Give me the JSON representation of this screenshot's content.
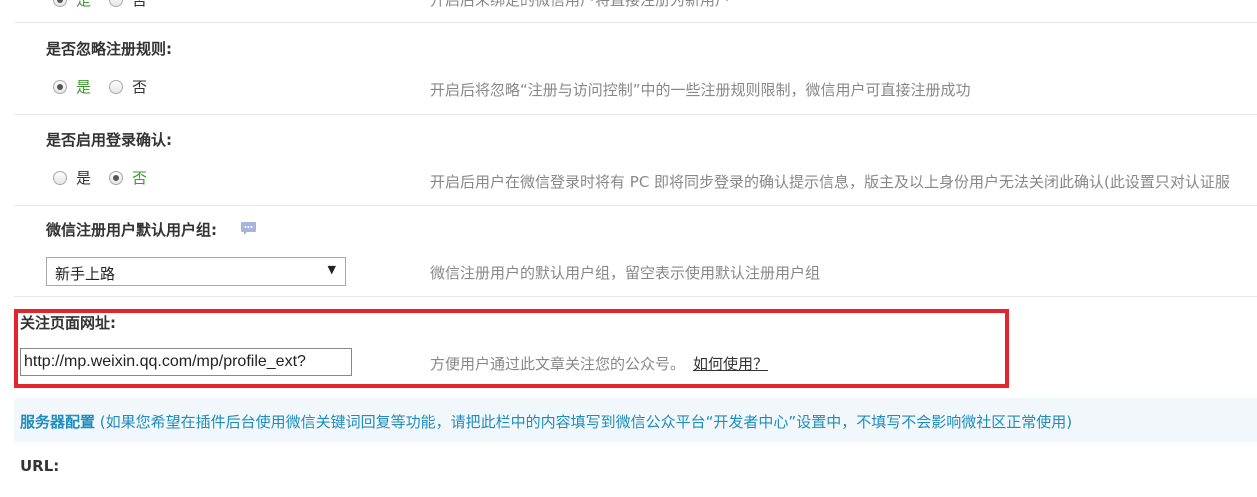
{
  "top_partial": {
    "yes": "是",
    "no": "否",
    "desc": "开启后未绑定的微信用户将直接注册为新用户"
  },
  "ignore_rules": {
    "label": "是否忽略注册规则:",
    "yes": "是",
    "no": "否",
    "selected": "yes",
    "desc": "开启后将忽略“注册与访问控制”中的一些注册规则限制，微信用户可直接注册成功"
  },
  "login_confirm": {
    "label": "是否启用登录确认:",
    "yes": "是",
    "no": "否",
    "selected": "no",
    "desc": "开启后用户在微信登录时将有 PC 即将同步登录的确认提示信息，版主及以上身份用户无法关闭此确认(此设置只对认证服"
  },
  "default_group": {
    "label": "微信注册用户默认用户组:",
    "help_icon": "comment-help-icon",
    "selected_value": "新手上路",
    "desc": "微信注册用户的默认用户组，留空表示使用默认注册用户组"
  },
  "follow_url": {
    "label": "关注页面网址:",
    "value": "http://mp.weixin.qq.com/mp/profile_ext?",
    "desc": "方便用户通过此文章关注您的公众号。",
    "link_text": "如何使用？",
    "highlight_color": "#e3262d"
  },
  "server_config": {
    "title": "服务器配置",
    "desc": "(如果您希望在插件后台使用微信关键词回复等功能，请把此栏中的内容填写到微信公众平台“开发者中心”设置中，不填写不会影响微社区正常使用)"
  },
  "url_field": {
    "label": "URL:"
  }
}
